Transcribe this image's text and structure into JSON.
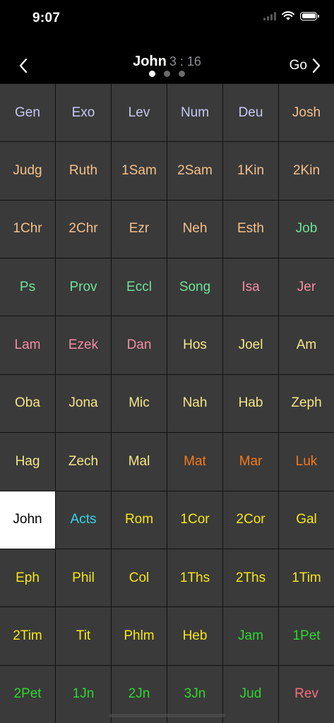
{
  "status": {
    "time": "9:07"
  },
  "nav": {
    "book": "John",
    "reference": "3 : 16",
    "go_label": "Go"
  },
  "colors": {
    "law": "#c8c8f5",
    "history": "#f5c08a",
    "poetry": "#6fe39a",
    "major_prophets": "#f58ca8",
    "minor_prophets": "#f5e68a",
    "gospels": "#f57a1a",
    "acts": "#2fd8e8",
    "pauline": "#f5e61a",
    "general": "#2fd62f",
    "revelation": "#f5707a"
  },
  "books": [
    {
      "label": "Gen",
      "group": "law"
    },
    {
      "label": "Exo",
      "group": "law"
    },
    {
      "label": "Lev",
      "group": "law"
    },
    {
      "label": "Num",
      "group": "law"
    },
    {
      "label": "Deu",
      "group": "law"
    },
    {
      "label": "Josh",
      "group": "history"
    },
    {
      "label": "Judg",
      "group": "history"
    },
    {
      "label": "Ruth",
      "group": "history"
    },
    {
      "label": "1Sam",
      "group": "history"
    },
    {
      "label": "2Sam",
      "group": "history"
    },
    {
      "label": "1Kin",
      "group": "history"
    },
    {
      "label": "2Kin",
      "group": "history"
    },
    {
      "label": "1Chr",
      "group": "history"
    },
    {
      "label": "2Chr",
      "group": "history"
    },
    {
      "label": "Ezr",
      "group": "history"
    },
    {
      "label": "Neh",
      "group": "history"
    },
    {
      "label": "Esth",
      "group": "history"
    },
    {
      "label": "Job",
      "group": "poetry"
    },
    {
      "label": "Ps",
      "group": "poetry"
    },
    {
      "label": "Prov",
      "group": "poetry"
    },
    {
      "label": "Eccl",
      "group": "poetry"
    },
    {
      "label": "Song",
      "group": "poetry"
    },
    {
      "label": "Isa",
      "group": "major_prophets"
    },
    {
      "label": "Jer",
      "group": "major_prophets"
    },
    {
      "label": "Lam",
      "group": "major_prophets"
    },
    {
      "label": "Ezek",
      "group": "major_prophets"
    },
    {
      "label": "Dan",
      "group": "major_prophets"
    },
    {
      "label": "Hos",
      "group": "minor_prophets"
    },
    {
      "label": "Joel",
      "group": "minor_prophets"
    },
    {
      "label": "Am",
      "group": "minor_prophets"
    },
    {
      "label": "Oba",
      "group": "minor_prophets"
    },
    {
      "label": "Jona",
      "group": "minor_prophets"
    },
    {
      "label": "Mic",
      "group": "minor_prophets"
    },
    {
      "label": "Nah",
      "group": "minor_prophets"
    },
    {
      "label": "Hab",
      "group": "minor_prophets"
    },
    {
      "label": "Zeph",
      "group": "minor_prophets"
    },
    {
      "label": "Hag",
      "group": "minor_prophets"
    },
    {
      "label": "Zech",
      "group": "minor_prophets"
    },
    {
      "label": "Mal",
      "group": "minor_prophets"
    },
    {
      "label": "Mat",
      "group": "gospels"
    },
    {
      "label": "Mar",
      "group": "gospels"
    },
    {
      "label": "Luk",
      "group": "gospels"
    },
    {
      "label": "John",
      "group": "gospels",
      "selected": true
    },
    {
      "label": "Acts",
      "group": "acts"
    },
    {
      "label": "Rom",
      "group": "pauline"
    },
    {
      "label": "1Cor",
      "group": "pauline"
    },
    {
      "label": "2Cor",
      "group": "pauline"
    },
    {
      "label": "Gal",
      "group": "pauline"
    },
    {
      "label": "Eph",
      "group": "pauline"
    },
    {
      "label": "Phil",
      "group": "pauline"
    },
    {
      "label": "Col",
      "group": "pauline"
    },
    {
      "label": "1Ths",
      "group": "pauline"
    },
    {
      "label": "2Ths",
      "group": "pauline"
    },
    {
      "label": "1Tim",
      "group": "pauline"
    },
    {
      "label": "2Tim",
      "group": "pauline"
    },
    {
      "label": "Tit",
      "group": "pauline"
    },
    {
      "label": "Phlm",
      "group": "pauline"
    },
    {
      "label": "Heb",
      "group": "pauline"
    },
    {
      "label": "Jam",
      "group": "general"
    },
    {
      "label": "1Pet",
      "group": "general"
    },
    {
      "label": "2Pet",
      "group": "general"
    },
    {
      "label": "1Jn",
      "group": "general"
    },
    {
      "label": "2Jn",
      "group": "general"
    },
    {
      "label": "3Jn",
      "group": "general"
    },
    {
      "label": "Jud",
      "group": "general"
    },
    {
      "label": "Rev",
      "group": "revelation"
    }
  ]
}
